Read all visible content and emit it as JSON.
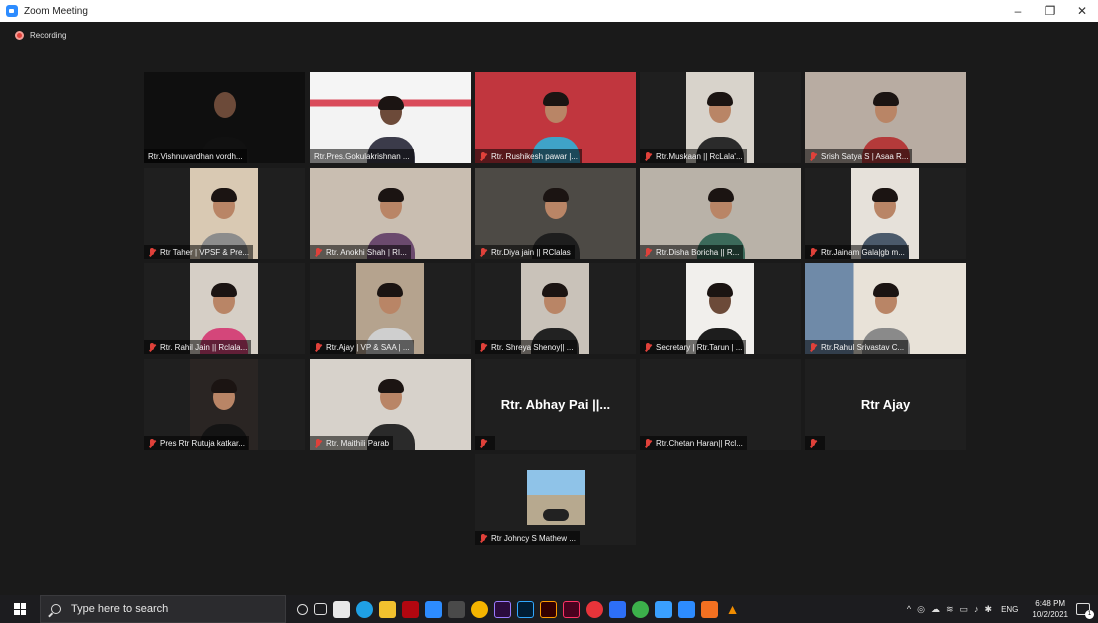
{
  "window": {
    "title": "Zoom Meeting",
    "minimize": "–",
    "maximize": "❐",
    "close": "✕"
  },
  "recording": {
    "label": "Recording",
    "color": "#e0413a"
  },
  "active_speaker_color": "#c9d95a",
  "participants": [
    {
      "name": "Rtr.Vishnuvardhan vordh...",
      "muted": false,
      "video": true,
      "active": true
    },
    {
      "name": "Rtr.Pres.Gokulakrishnan ...",
      "muted": false,
      "video": true
    },
    {
      "name": "Rtr. Rushikesh pawar |...",
      "muted": true,
      "video": true
    },
    {
      "name": "Rtr.Muskaan || RcLala'...",
      "muted": true,
      "video": true
    },
    {
      "name": "Srish Satya S | Asaa R...",
      "muted": true,
      "video": true
    },
    {
      "name": "Rtr Taher | VPSF & Pre...",
      "muted": true,
      "video": true
    },
    {
      "name": "Rtr. Anokhi Shah | RI...",
      "muted": true,
      "video": true
    },
    {
      "name": "Rtr.Diya jain || RClalas",
      "muted": true,
      "video": true
    },
    {
      "name": "Rtr.Disha Boricha || R...",
      "muted": true,
      "video": true
    },
    {
      "name": "Rtr.Jainam Gala|gb m...",
      "muted": true,
      "video": true
    },
    {
      "name": "Rtr. Rahil Jain || Rclala...",
      "muted": true,
      "video": true
    },
    {
      "name": "Rtr.Ajay | VP & SAA | ...",
      "muted": true,
      "video": true
    },
    {
      "name": "Rtr. Shreya Shenoy|| ...",
      "muted": true,
      "video": true
    },
    {
      "name": "Secretary | Rtr.Tarun | ...",
      "muted": true,
      "video": true
    },
    {
      "name": "Rtr.Rahul Srivastav C...",
      "muted": true,
      "video": true
    },
    {
      "name": "Pres Rtr Rutuja katkar...",
      "muted": true,
      "video": true
    },
    {
      "name": "Rtr. Maithili Parab",
      "muted": true,
      "video": true
    },
    {
      "name": "",
      "muted": true,
      "video": false,
      "display_name": "Rtr. Abhay Pai ||..."
    },
    {
      "name": "Rtr.Chetan Haran|| Rcl...",
      "muted": true,
      "video": false,
      "display_name": ""
    },
    {
      "name": "",
      "muted": true,
      "video": false,
      "display_name": "Rtr Ajay"
    },
    {
      "name": "Rtr Johncy S Mathew ...",
      "muted": true,
      "video": true
    }
  ],
  "taskbar": {
    "search_placeholder": "Type here to search",
    "language": "ENG",
    "time": "6:48 PM",
    "date": "10/2/2021",
    "notifications": "1"
  }
}
